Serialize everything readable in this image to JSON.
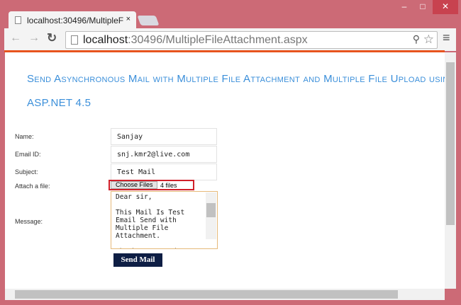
{
  "browser": {
    "tab_title": "localhost:30496/MultipleF",
    "url_host": "localhost",
    "url_rest": ":30496/MultipleFileAttachment.aspx"
  },
  "page": {
    "heading_line1": "Send Asynchronous Mail with Multiple File Attachment and Multiple File Upload using",
    "heading_line2": "ASP.NET 4.5",
    "form": {
      "name_label": "Name:",
      "name_value": "Sanjay",
      "email_label": "Email ID:",
      "email_value": "snj.kmr2@live.com",
      "subject_label": "Subject:",
      "subject_value": "Test Mail",
      "attach_label": "Attach a file:",
      "choose_files": "Choose Files",
      "files_status": "4 files",
      "message_label": "Message:",
      "message_value": "Dear sir,\n\nThis Mail Is Test Email Send with Multiple File Attachment.\n\nThanks & Regards,",
      "send_button": "Send Mail"
    }
  }
}
